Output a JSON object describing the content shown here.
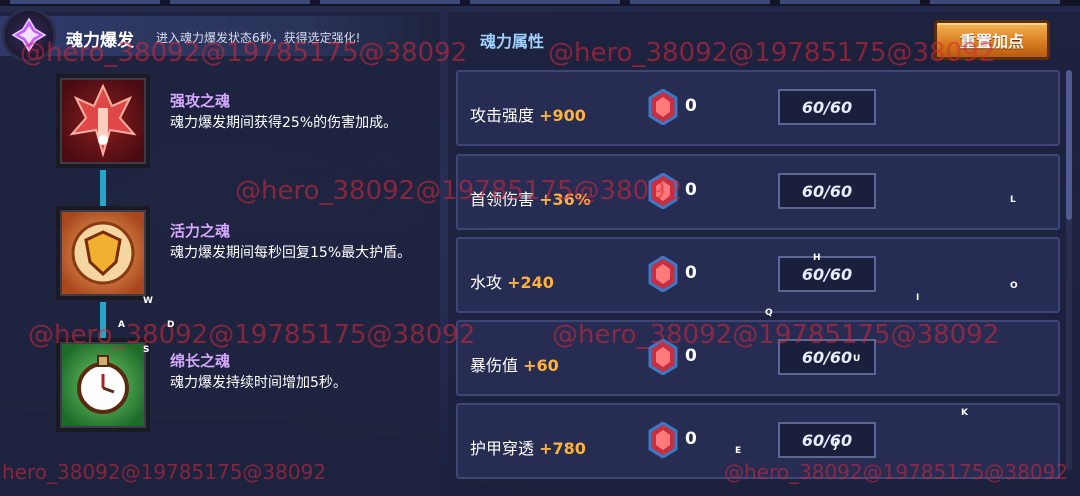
{
  "header": {
    "title": "魂力爆发",
    "description": "进入魂力爆发状态6秒，获得选定强化!"
  },
  "skills": [
    {
      "name": "强攻之魂",
      "desc": "魂力爆发期间获得25%的伤害加成。"
    },
    {
      "name": "活力之魂",
      "desc": "魂力爆发期间每秒回复15%最大护盾。"
    },
    {
      "name": "绵长之魂",
      "desc": "魂力爆发持续时间增加5秒。"
    }
  ],
  "attributes": {
    "title": "魂力属性",
    "reset_label": "重置加点",
    "rows": [
      {
        "label": "攻击强度",
        "bonus": "+900",
        "gems": "0",
        "cap": "60/60"
      },
      {
        "label": "首领伤害",
        "bonus": "+36%",
        "gems": "0",
        "cap": "60/60"
      },
      {
        "label": "水攻",
        "bonus": "+240",
        "gems": "0",
        "cap": "60/60"
      },
      {
        "label": "暴伤值",
        "bonus": "+60",
        "gems": "0",
        "cap": "60/60"
      },
      {
        "label": "护甲穿透",
        "bonus": "+780",
        "gems": "0",
        "cap": "60/60"
      }
    ]
  },
  "watermarks": {
    "w1": "@hero_38092@19785175@38092",
    "w2": "@hero_38092@19785175@38092",
    "w3": "@hero_38092@19785175@38092",
    "w4": "@hero_38092@19785175@38092",
    "w5": "@hero_38092@19785175@38092",
    "w6": "hero_38092@19785175@38092",
    "w7": "@hero_38092@19785175@38092"
  },
  "key_hints": {
    "w": "W",
    "a": "A",
    "d": "D",
    "s": "S",
    "q": "Q",
    "e": "E",
    "h": "H",
    "i": "I",
    "o": "O",
    "l": "L",
    "u": "U",
    "j": "J",
    "k": "K"
  },
  "colors": {
    "skill_name": "#d6a8ff",
    "bonus": "#ffb23a",
    "connector": "#28a6c8",
    "reset_button": "#e48a2a",
    "watermark": "#dc283c"
  }
}
